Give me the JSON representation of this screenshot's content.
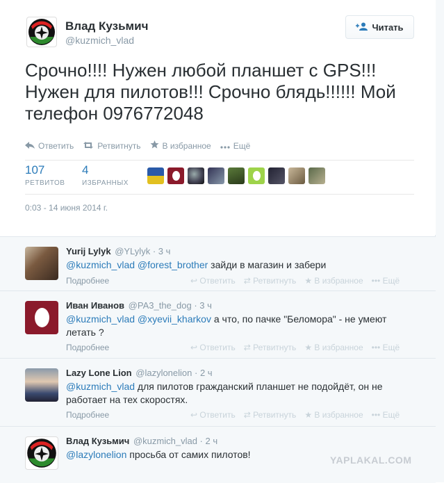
{
  "author": {
    "name": "Влад Кузьмич",
    "handle": "@kuzmich_vlad"
  },
  "follow_label": "Читать",
  "tweet_text": "Срочно!!!! Нужен любой планшет с GPS!!! Нужен для пилотов!!! Срочно блядь!!!!!! Мой телефон 0976772048",
  "actions": {
    "reply": "Ответить",
    "retweet": "Ретвитнуть",
    "favorite": "В избранное",
    "more": "Ещё"
  },
  "stats": {
    "retweets_count": "107",
    "retweets_label": "РЕТВИТОВ",
    "favorites_count": "4",
    "favorites_label": "ИЗБРАННЫХ"
  },
  "timestamp": "0:03 - 14 июня 2014 г.",
  "replies": [
    {
      "name": "Yurij Lylyk",
      "handle": "@YLylyk",
      "time": "· 3 ч",
      "mentions": "@kuzmich_vlad @forest_brother",
      "text": " зайди в магазин и забери",
      "more": "Подробнее"
    },
    {
      "name": "Иван Иванов",
      "handle": "@PA3_the_dog",
      "time": "· 3 ч",
      "mentions": "@kuzmich_vlad @xyevii_kharkov",
      "text": " а что, по пачке \"Беломора\" - не умеют летать ?",
      "more": "Подробнее"
    },
    {
      "name": "Lazy Lone Lion",
      "handle": "@lazylonelion",
      "time": "· 2 ч",
      "mentions": "@kuzmich_vlad",
      "text": " для пилотов гражданский планшет не подойдёт, он не работает на тех скоростях.",
      "more": "Подробнее"
    },
    {
      "name": "Влад Кузьмич",
      "handle": "@kuzmich_vlad",
      "time": "· 2 ч",
      "mentions": "@lazylonelion",
      "text": " просьба от самих пилотов!",
      "more": ""
    }
  ],
  "watermark": "YAPLAKAL.COM",
  "colors": {
    "link": "#2b7bb9",
    "muted": "#8899a6",
    "reply_bg": "#f5f8fa"
  }
}
